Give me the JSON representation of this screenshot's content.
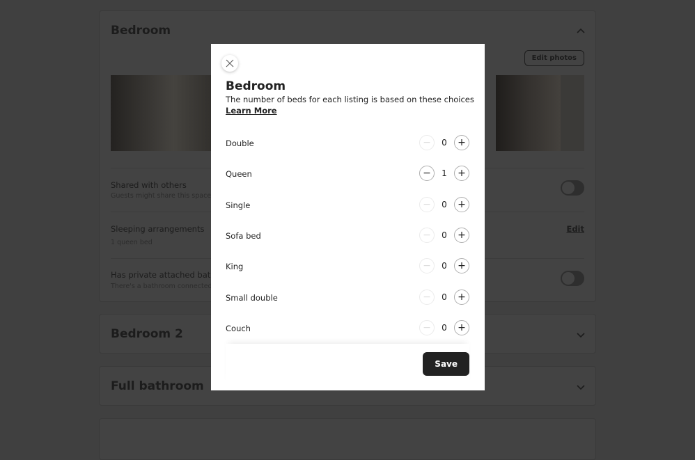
{
  "page": {
    "bedroom": {
      "title": "Bedroom",
      "edit_photos": "Edit photos",
      "rows": [
        {
          "title": "Shared with others",
          "subtitle": "Guests might share this space w",
          "control": "toggle",
          "on": false
        },
        {
          "title": "Sleeping arrangements",
          "subtitle": "1 queen bed",
          "action": "Edit"
        },
        {
          "title": "Has private attached bathro",
          "subtitle": "There's a bathroom connected t",
          "control": "toggle",
          "on": false
        }
      ]
    },
    "sections": [
      {
        "title": "Bedroom 2"
      },
      {
        "title": "Full bathroom"
      }
    ]
  },
  "modal": {
    "title": "Bedroom",
    "subtitle": "The number of beds for each listing is based on these choices",
    "learn_more": "Learn More",
    "beds": [
      {
        "label": "Double",
        "count": "0"
      },
      {
        "label": "Queen",
        "count": "1"
      },
      {
        "label": "Single",
        "count": "0"
      },
      {
        "label": "Sofa bed",
        "count": "0"
      },
      {
        "label": "King",
        "count": "0"
      },
      {
        "label": "Small double",
        "count": "0"
      },
      {
        "label": "Couch",
        "count": "0"
      }
    ],
    "save": "Save"
  }
}
